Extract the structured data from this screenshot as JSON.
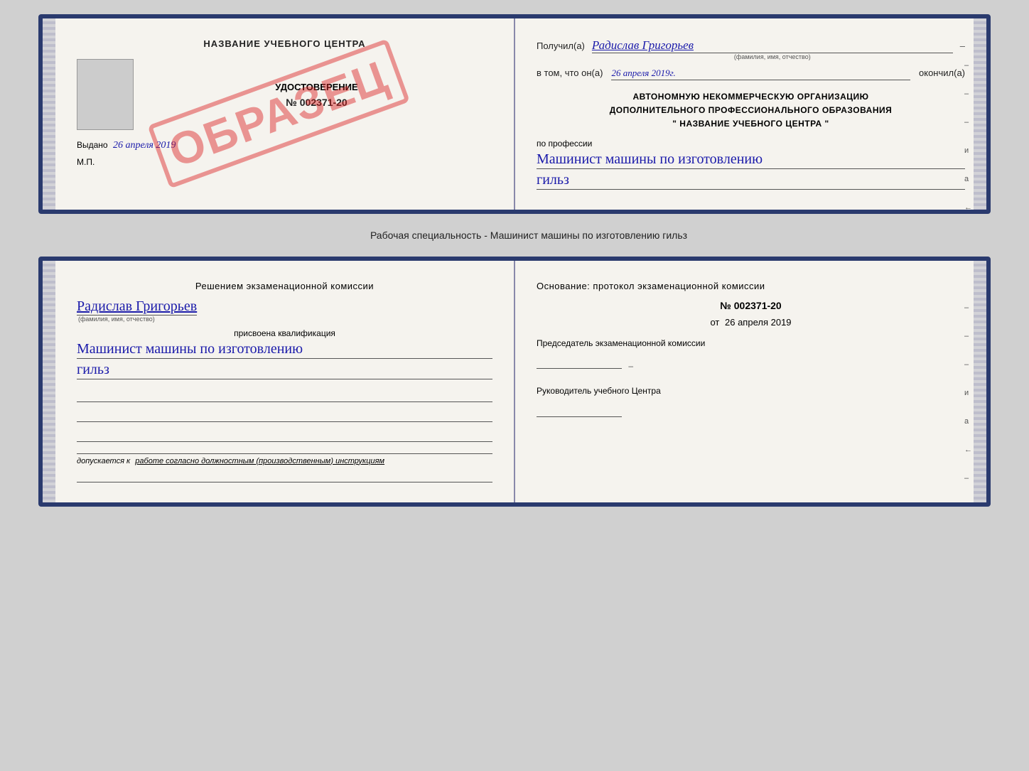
{
  "top_card": {
    "left": {
      "center_title": "НАЗВАНИЕ УЧЕБНОГО ЦЕНТРА",
      "cert_doc_title": "УДОСТОВЕРЕНИЕ",
      "cert_number": "№ 002371-20",
      "issued_label": "Выдано",
      "issued_date": "26 апреля 2019",
      "mp_label": "М.П.",
      "stamp_text": "ОБРАЗЕЦ"
    },
    "right": {
      "received_label": "Получил(а)",
      "fio_value": "Радислав Григорьев",
      "fio_subtitle": "(фамилия, имя, отчество)",
      "date_prefix": "в том, что он(а)",
      "date_value": "26 апреля 2019г.",
      "date_suffix": "окончил(а)",
      "org_line1": "АВТОНОМНУЮ НЕКОММЕРЧЕСКУЮ ОРГАНИЗАЦИЮ",
      "org_line2": "ДОПОЛНИТЕЛЬНОГО ПРОФЕССИОНАЛЬНОГО ОБРАЗОВАНИЯ",
      "org_line3": "\"  НАЗВАНИЕ УЧЕБНОГО ЦЕНТРА  \"",
      "profession_prefix": "по профессии",
      "profession_value": "Машинист машины по изготовлению",
      "profession_value2": "гильз",
      "dashes": [
        "–",
        "–",
        "–",
        "и",
        "а",
        "←",
        "–",
        "–",
        "–"
      ]
    }
  },
  "separator": {
    "label": "Рабочая специальность - Машинист машины по изготовлению гильз"
  },
  "bottom_card": {
    "left": {
      "decision_title": "Решением  экзаменационной  комиссии",
      "fio_value": "Радислав Григорьев",
      "fio_subtitle": "(фамилия, имя, отчество)",
      "qualification_label": "присвоена квалификация",
      "qualification_value": "Машинист машины по изготовлению",
      "qualification_value2": "гильз",
      "admission_prefix": "допускается к",
      "admission_value": "работе согласно должностным (производственным) инструкциям"
    },
    "right": {
      "basis_title": "Основание: протокол экзаменационной  комиссии",
      "protocol_number": "№  002371-20",
      "date_prefix": "от",
      "protocol_date": "26 апреля 2019",
      "chairman_label": "Председатель экзаменационной комиссии",
      "head_label": "Руководитель учебного Центра",
      "dashes": [
        "–",
        "–",
        "–",
        "и",
        "а",
        "←",
        "–",
        "–",
        "–"
      ]
    }
  }
}
